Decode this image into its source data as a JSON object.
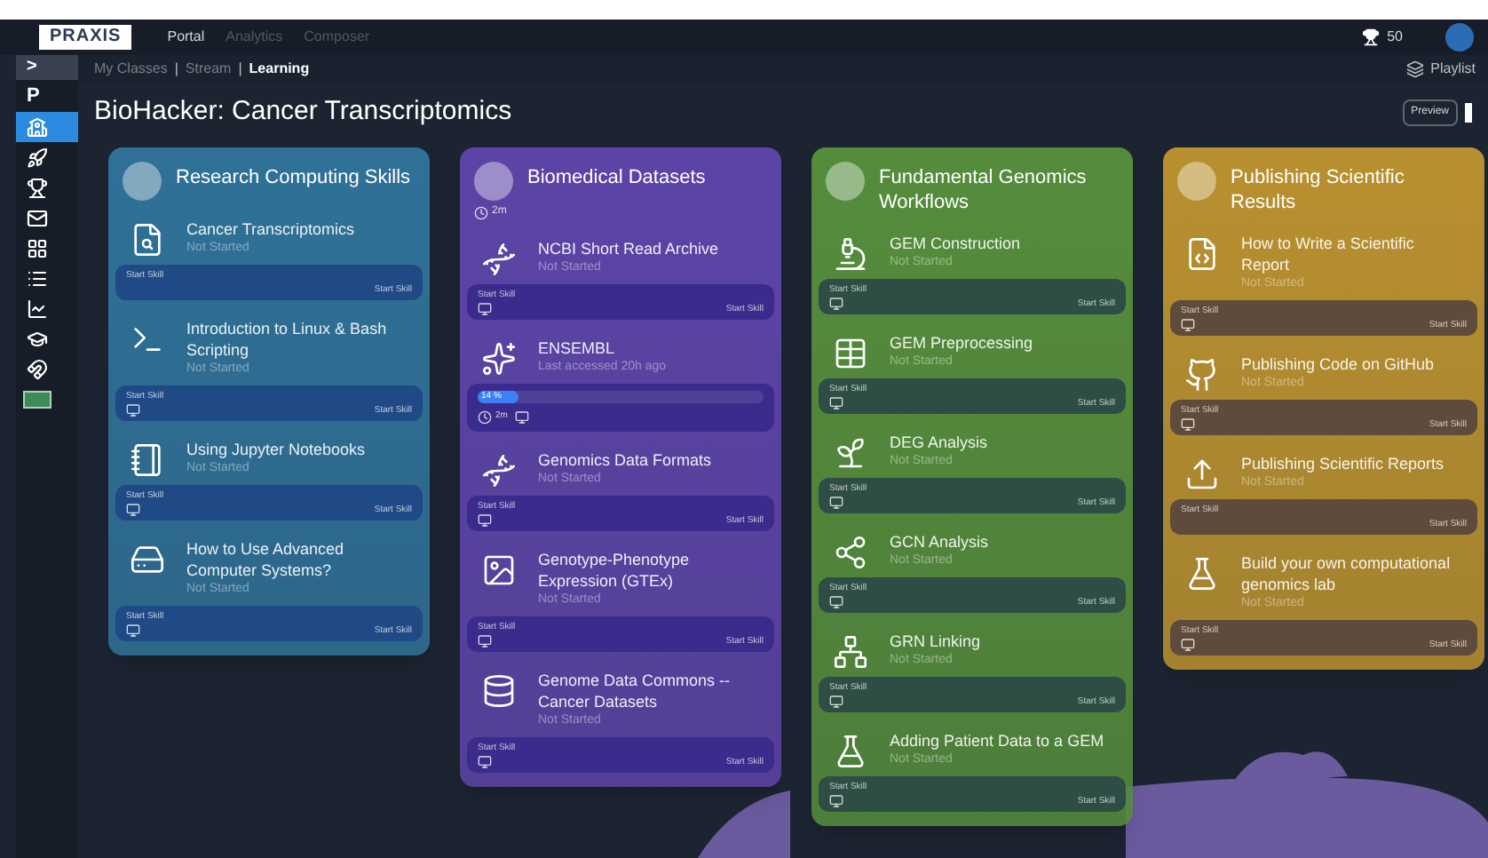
{
  "topbar": {
    "logo": "PRAXIS",
    "nav": [
      {
        "label": "Portal",
        "selected": true
      },
      {
        "label": "Analytics",
        "selected": false
      },
      {
        "label": "Composer",
        "selected": false
      }
    ],
    "trophies": "50"
  },
  "sidebar": {
    "toggle": ">",
    "letter": "P",
    "items": [
      {
        "selected": true
      },
      {
        "selected": false
      },
      {
        "selected": false
      },
      {
        "selected": false
      },
      {
        "selected": false
      },
      {
        "selected": false
      },
      {
        "selected": false
      },
      {
        "selected": false
      },
      {
        "selected": false
      }
    ]
  },
  "breadcrumb": [
    {
      "label": "My Classes",
      "selected": false
    },
    {
      "label": "Stream",
      "selected": false
    },
    {
      "label": "Learning",
      "selected": true
    }
  ],
  "breadcrumb_separator": "|",
  "playlists": "Playlist",
  "title": "BioHacker: Cancer Transcriptomics",
  "preview": "Preview",
  "courses": [
    {
      "title": "Research Computing Skills",
      "color": "#2f7197",
      "skills": [
        {
          "kind": "standard",
          "title": "Cancer Transcriptomics",
          "status": "Not Started",
          "bar_label": "Start Skill",
          "action": "Start Skill",
          "device": false
        },
        {
          "kind": "standard",
          "title": "Introduction to Linux & Bash Scripting",
          "status": "Not Started",
          "bar_label": "Start Skill",
          "action": "Start Skill",
          "device": true
        },
        {
          "kind": "standard",
          "title": "Using Jupyter Notebooks",
          "status": "Not Started",
          "bar_label": "Start Skill",
          "action": "Start Skill",
          "device": true
        },
        {
          "kind": "standard",
          "title": "How to Use Advanced Computer Systems?",
          "status": "Not Started",
          "bar_label": "Start Skill",
          "action": "Start Skill",
          "device": true
        }
      ]
    },
    {
      "title": "Biomedical Datasets",
      "color": "#5c44a6",
      "duration": "2m",
      "skills": [
        {
          "kind": "standard",
          "title": "NCBI Short Read Archive",
          "status": "Not Started",
          "bar_label": "Start Skill",
          "action": "Start Skill",
          "device": true
        },
        {
          "kind": "progress",
          "title": "ENSEMBL",
          "status": "Last accessed 20h ago",
          "level": 0.14,
          "progress_label": "14 %",
          "duration": "2m"
        },
        {
          "kind": "standard",
          "title": "Genomics Data Formats",
          "status": "Not Started",
          "bar_label": "Start Skill",
          "action": "Start Skill",
          "device": true
        },
        {
          "kind": "standard",
          "title": "Genotype-Phenotype Expression (GTEx)",
          "status": "Not Started",
          "bar_label": "Start Skill",
          "action": "Start Skill",
          "device": true
        },
        {
          "kind": "standard",
          "title": "Genome Data Commons -- Cancer Datasets",
          "status": "Not Started",
          "bar_label": "Start Skill",
          "action": "Start Skill",
          "device": true
        }
      ]
    },
    {
      "title": "Fundamental Genomics Workflows",
      "color": "#558c3c",
      "skills": [
        {
          "kind": "standard",
          "title": "GEM Construction",
          "status": "Not Started",
          "bar_label": "Start Skill",
          "action": "Start Skill",
          "device": true
        },
        {
          "kind": "standard",
          "title": "GEM Preprocessing",
          "status": "Not Started",
          "bar_label": "Start Skill",
          "action": "Start Skill",
          "device": true
        },
        {
          "kind": "standard",
          "title": "DEG Analysis",
          "status": "Not Started",
          "bar_label": "Start Skill",
          "action": "Start Skill",
          "device": true
        },
        {
          "kind": "standard",
          "title": "GCN Analysis",
          "status": "Not Started",
          "bar_label": "Start Skill",
          "action": "Start Skill",
          "device": true
        },
        {
          "kind": "standard",
          "title": "GRN Linking",
          "status": "Not Started",
          "bar_label": "Start Skill",
          "action": "Start Skill",
          "device": true
        },
        {
          "kind": "standard",
          "title": "Adding Patient Data to a GEM",
          "status": "Not Started",
          "bar_label": "Start Skill",
          "action": "Start Skill",
          "device": true
        }
      ]
    },
    {
      "title": "Publishing Scientific Results",
      "color": "#b8902f",
      "skills": [
        {
          "kind": "standard",
          "title": "How to Write a Scientific Report",
          "status": "Not Started",
          "bar_label": "Start Skill",
          "action": "Start Skill",
          "device": true
        },
        {
          "kind": "standard",
          "title": "Publishing Code on GitHub",
          "status": "Not Started",
          "bar_label": "Start Skill",
          "action": "Start Skill",
          "device": true
        },
        {
          "kind": "standard",
          "title": "Publishing Scientific Reports",
          "status": "Not Started",
          "bar_label": "Start Skill",
          "action": "Start Skill",
          "device": false
        },
        {
          "kind": "standard",
          "title": "Build your own computational genomics lab",
          "status": "Not Started",
          "bar_label": "Start Skill",
          "action": "Start Skill",
          "device": true
        }
      ]
    }
  ]
}
